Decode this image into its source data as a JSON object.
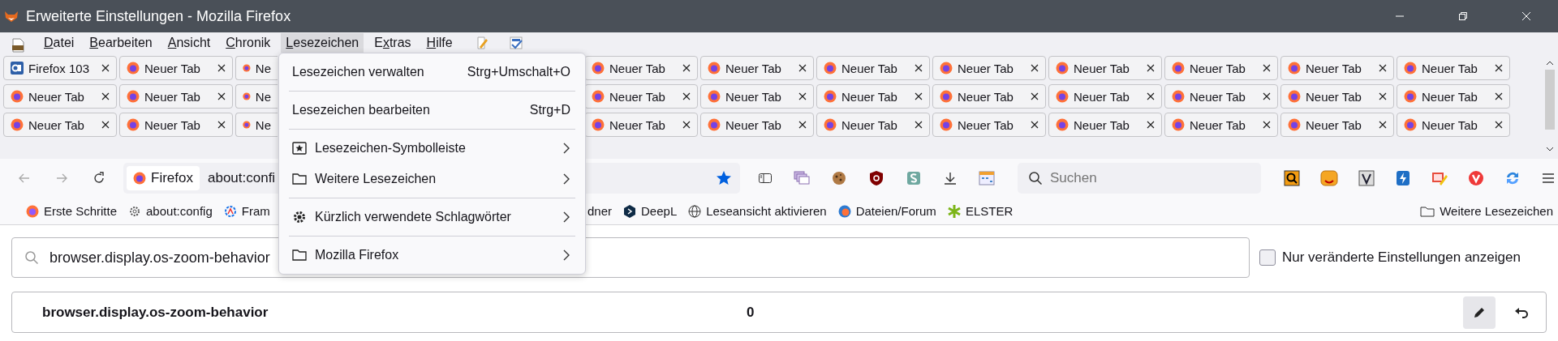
{
  "window": {
    "title": "Erweiterte Einstellungen - Mozilla Firefox"
  },
  "menubar": [
    {
      "key": "D",
      "after": "atei",
      "selected": false
    },
    {
      "key": "B",
      "after": "earbeiten",
      "selected": false
    },
    {
      "key": "A",
      "after": "nsicht",
      "selected": false
    },
    {
      "key": "C",
      "after": "hronik",
      "selected": false
    },
    {
      "key": "L",
      "after": "esezeichen",
      "selected": true
    },
    {
      "before": "E",
      "key": "x",
      "after": "tras",
      "selected": false
    },
    {
      "key": "H",
      "after": "ilfe",
      "selected": false
    }
  ],
  "tab_rows": [
    {
      "left": [
        {
          "label": "Firefox 103"
        },
        {
          "label": "Neuer Tab"
        },
        {
          "label": "Ne"
        }
      ],
      "right": [
        {
          "label": "Neuer Tab"
        },
        {
          "label": "Neuer Tab"
        },
        {
          "label": "Neuer Tab"
        },
        {
          "label": "Neuer Tab"
        },
        {
          "label": "Neuer Tab"
        },
        {
          "label": "Neuer Tab"
        },
        {
          "label": "Neuer Tab"
        },
        {
          "label": "Neuer Tab"
        }
      ]
    },
    {
      "left": [
        {
          "label": "Neuer Tab"
        },
        {
          "label": "Neuer Tab"
        },
        {
          "label": "Ne"
        }
      ],
      "right": [
        {
          "label": "Neuer Tab"
        },
        {
          "label": "Neuer Tab"
        },
        {
          "label": "Neuer Tab"
        },
        {
          "label": "Neuer Tab"
        },
        {
          "label": "Neuer Tab"
        },
        {
          "label": "Neuer Tab"
        },
        {
          "label": "Neuer Tab"
        },
        {
          "label": "Neuer Tab"
        }
      ]
    },
    {
      "left": [
        {
          "label": "Neuer Tab"
        },
        {
          "label": "Neuer Tab"
        },
        {
          "label": "Ne"
        }
      ],
      "right": [
        {
          "label": "Neuer Tab"
        },
        {
          "label": "Neuer Tab"
        },
        {
          "label": "Neuer Tab"
        },
        {
          "label": "Neuer Tab"
        },
        {
          "label": "Neuer Tab"
        },
        {
          "label": "Neuer Tab"
        },
        {
          "label": "Neuer Tab"
        },
        {
          "label": "Neuer Tab"
        }
      ]
    }
  ],
  "urlbar": {
    "identity": "Firefox",
    "url": "about:confi"
  },
  "search": {
    "placeholder": "Suchen"
  },
  "bookmarks": {
    "left": [
      {
        "label": "Erste Schritte"
      },
      {
        "label": "about:config"
      },
      {
        "label": "Fram"
      }
    ],
    "right": [
      {
        "label": "dner"
      },
      {
        "label": "DeepL"
      },
      {
        "label": "Leseansicht aktivieren"
      },
      {
        "label": "Dateien/Forum"
      },
      {
        "label": "ELSTER"
      }
    ],
    "other": {
      "label": "Weitere Lesezeichen"
    }
  },
  "menu": {
    "groups": [
      [
        {
          "kind": "shortcut",
          "label": "Lesezeichen verwalten",
          "shortcut": "Strg+Umschalt+O"
        }
      ],
      [
        {
          "kind": "shortcut",
          "label": "Lesezeichen bearbeiten",
          "shortcut": "Strg+D"
        }
      ],
      [
        {
          "kind": "submenu",
          "label": "Lesezeichen-Symbolleiste"
        },
        {
          "kind": "submenu",
          "label": "Weitere Lesezeichen"
        }
      ],
      [
        {
          "kind": "submenu",
          "label": "Kürzlich verwendete Schlagwörter"
        }
      ],
      [
        {
          "kind": "submenu",
          "label": "Mozilla Firefox"
        }
      ]
    ]
  },
  "config": {
    "filter": {
      "value": "browser.display.os-zoom-behavior"
    },
    "modified_only": {
      "label": "Nur veränderte Einstellungen anzeigen",
      "checked": false
    },
    "prefs": [
      {
        "name": "browser.display.os-zoom-behavior",
        "value": "0"
      }
    ]
  }
}
